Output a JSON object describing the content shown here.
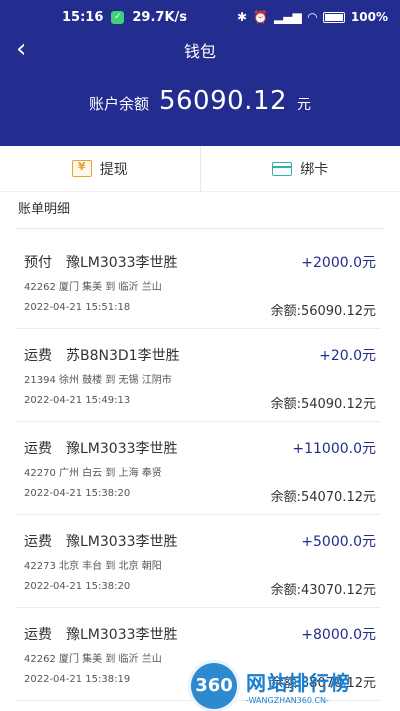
{
  "status": {
    "time": "15:16",
    "speed": "29.7K/s",
    "battery": "100%"
  },
  "header": {
    "back_glyph": "‹",
    "title": "钱包",
    "balance_label": "账户余额",
    "balance_value": "56090.12",
    "balance_unit": "元"
  },
  "actions": {
    "withdraw": "提现",
    "bind_card": "绑卡"
  },
  "section_title": "账单明细",
  "transactions": [
    {
      "title": "预付　豫LM3033李世胜",
      "amount": "+2000.0元",
      "route": "42262 厦门 集美 到 临沂 兰山",
      "time": "2022-04-21 15:51:18",
      "balance": "余额:56090.12元"
    },
    {
      "title": "运费　苏B8N3D1李世胜",
      "amount": "+20.0元",
      "route": "21394 徐州 鼓楼 到 无锡 江阴市",
      "time": "2022-04-21 15:49:13",
      "balance": "余额:54090.12元"
    },
    {
      "title": "运费　豫LM3033李世胜",
      "amount": "+11000.0元",
      "route": "42270 广州 白云 到 上海 奉贤",
      "time": "2022-04-21 15:38:20",
      "balance": "余额:54070.12元"
    },
    {
      "title": "运费　豫LM3033李世胜",
      "amount": "+5000.0元",
      "route": "42273 北京 丰台 到 北京 朝阳",
      "time": "2022-04-21 15:38:20",
      "balance": "余额:43070.12元"
    },
    {
      "title": "运费　豫LM3033李世胜",
      "amount": "+8000.0元",
      "route": "42262 厦门 集美 到 临沂 兰山",
      "time": "2022-04-21 15:38:19",
      "balance": "余额:38070.12元"
    }
  ],
  "watermark": {
    "logo": "360",
    "title": "网站排行榜",
    "sub": "-WANGZHAN360.CN-"
  }
}
